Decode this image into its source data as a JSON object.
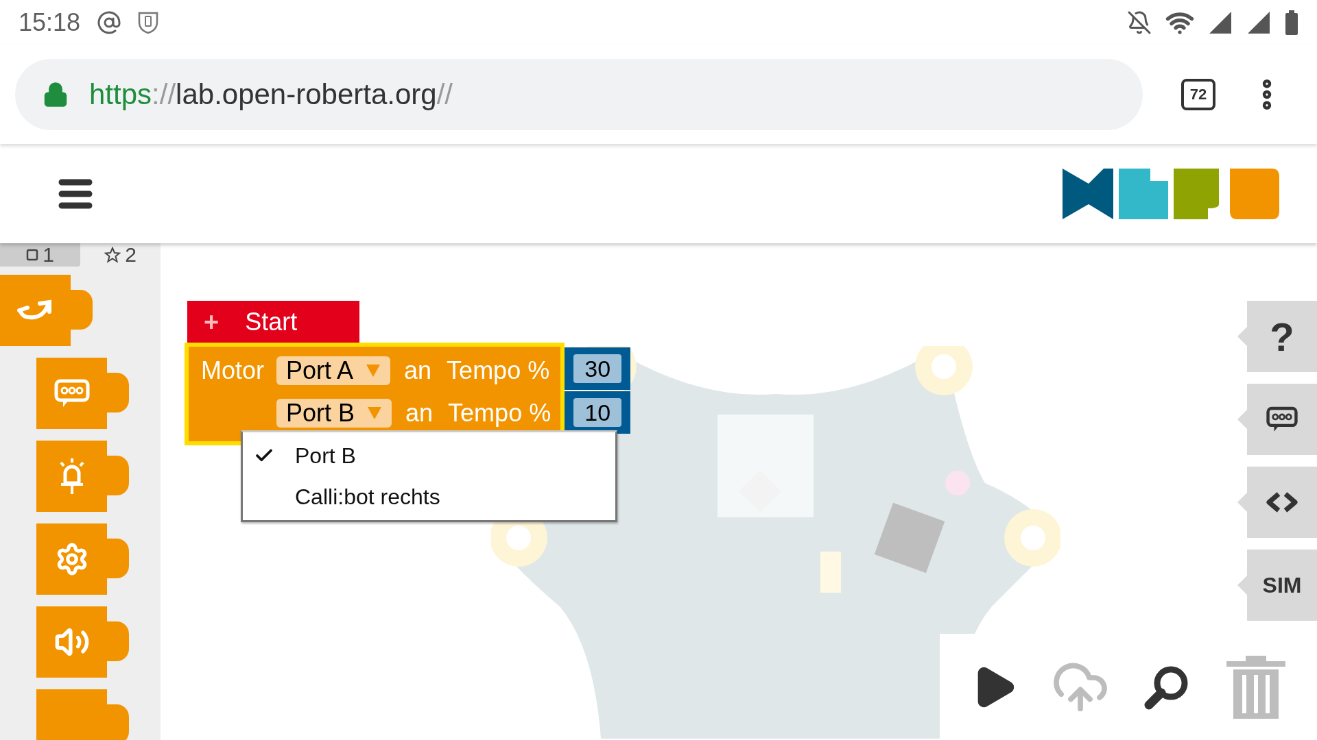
{
  "status_bar": {
    "time": "15:18"
  },
  "browser": {
    "url_scheme": "https",
    "url_separator": "://",
    "url_host": "lab.open-roberta.org",
    "url_path": "//",
    "tab_count": "72"
  },
  "program_tabs": [
    {
      "kind": "square",
      "label": "1",
      "selected": true
    },
    {
      "kind": "star",
      "label": "2",
      "selected": false
    }
  ],
  "categories": [
    {
      "kind": "action",
      "selected": true
    },
    {
      "kind": "display",
      "selected": false
    },
    {
      "kind": "light",
      "selected": false
    },
    {
      "kind": "control",
      "selected": false
    },
    {
      "kind": "sound",
      "selected": false
    },
    {
      "kind": "more",
      "selected": false
    }
  ],
  "start_block": {
    "icon": "+",
    "label": "Start"
  },
  "motor_block": {
    "label": "Motor",
    "selected": true,
    "rows": [
      {
        "port": "Port A",
        "connector": "an",
        "parameter": "Tempo %",
        "value": "30"
      },
      {
        "port": "Port B",
        "connector": "an",
        "parameter": "Tempo %",
        "value": "10"
      }
    ]
  },
  "dropdown": {
    "items": [
      {
        "label": "Port B",
        "checked": true
      },
      {
        "label": "Calli:bot rechts",
        "checked": false
      }
    ]
  },
  "side_buttons": [
    {
      "kind": "text",
      "label": "?"
    },
    {
      "kind": "comment"
    },
    {
      "kind": "code"
    },
    {
      "kind": "text",
      "label": "SIM"
    }
  ],
  "toolbar": [
    {
      "kind": "run",
      "disabled": false
    },
    {
      "kind": "upload",
      "disabled": true
    },
    {
      "kind": "zoom",
      "disabled": false
    },
    {
      "kind": "trash",
      "disabled": true
    }
  ]
}
